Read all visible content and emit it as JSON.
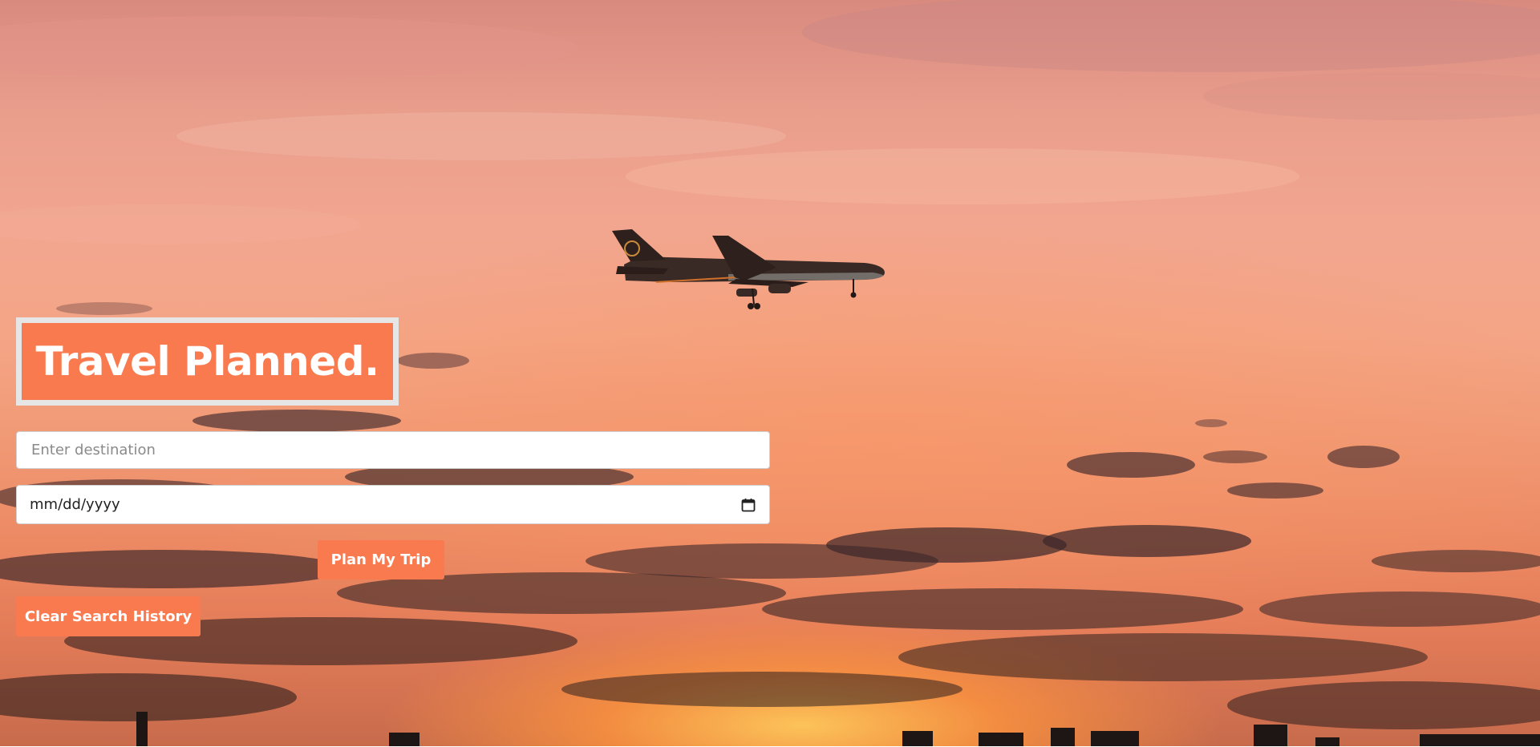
{
  "hero": {
    "title": "Travel Planned."
  },
  "search": {
    "destination_placeholder": "Enter destination",
    "destination_value": "",
    "date_placeholder": "mm/dd/yyyy"
  },
  "actions": {
    "plan_label": "Plan My Trip",
    "clear_label": "Clear Search History"
  },
  "icons": {
    "calendar": "calendar-icon"
  },
  "colors": {
    "accent": "#fa7a4f",
    "title_border": "#e6e6e6",
    "button_text": "#ffffff"
  }
}
